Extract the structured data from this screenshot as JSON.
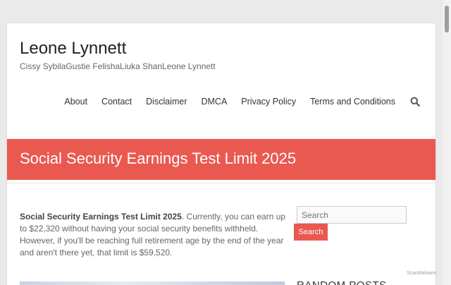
{
  "site": {
    "title": "Leone Lynnett",
    "description": "Cissy SybilaGustie FelishaLiuka ShanLeone Lynnett"
  },
  "nav": {
    "items": [
      "About",
      "Contact",
      "Disclaimer",
      "DMCA",
      "Privacy Policy",
      "Terms and Conditions"
    ],
    "search_icon": "search-icon"
  },
  "banner": {
    "title": "Social Security Earnings Test Limit 2025",
    "color": "#ea5950"
  },
  "article": {
    "lead_bold": "Social Security Earnings Test Limit 2025",
    "lead_rest": ". Currently, you can earn up to $22,320 without having your social security benefits withheld. However, if you'll be reaching full retirement age by the end of the year and aren't there yet, that limit is $59,520."
  },
  "sidebar": {
    "search_placeholder": "Search",
    "search_button": "Search",
    "random_posts_heading": "RANDOM POSTS"
  },
  "watermark": "ScanMalware"
}
